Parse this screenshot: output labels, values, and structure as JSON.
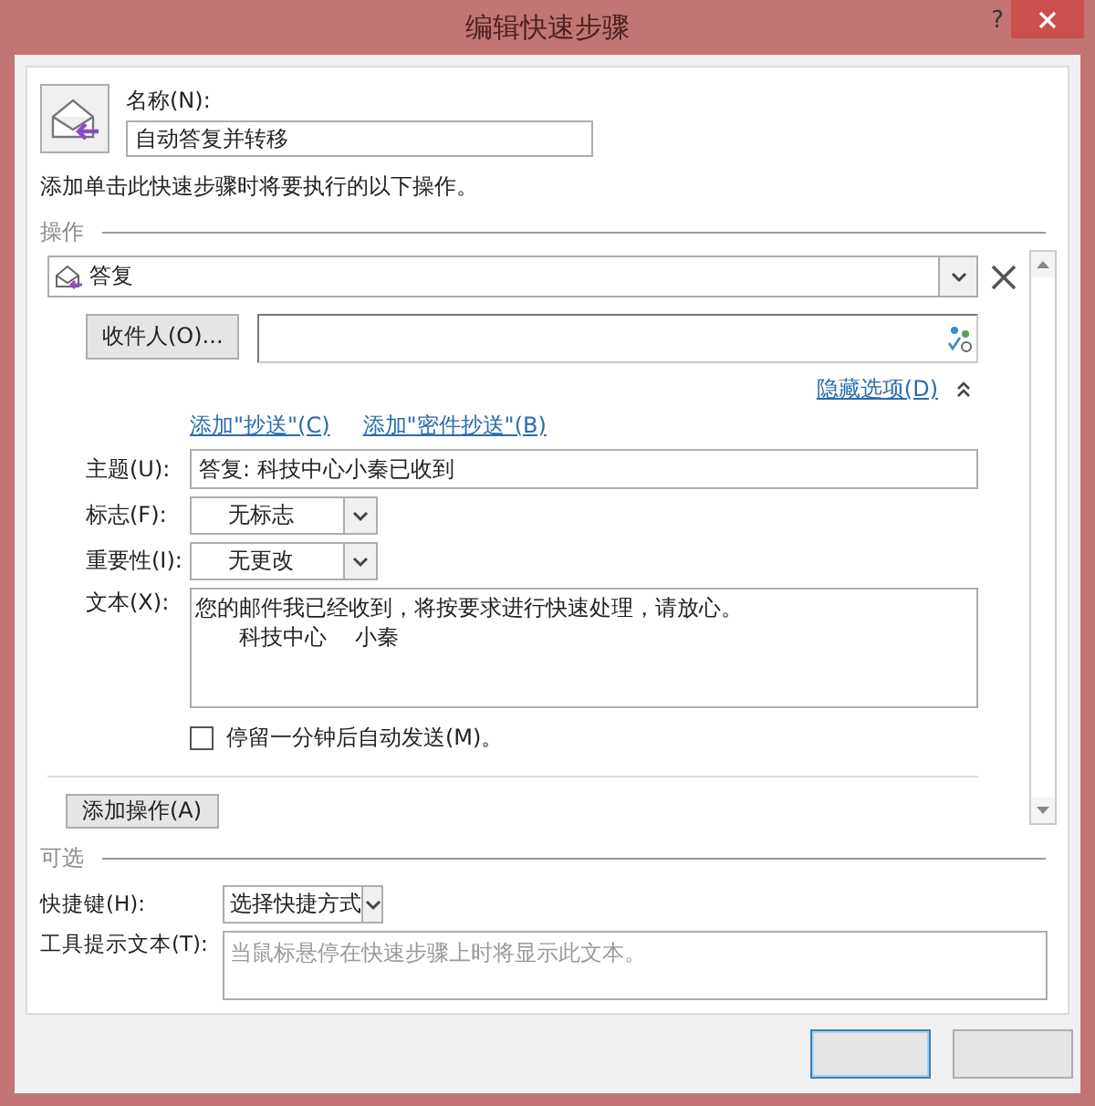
{
  "window": {
    "title": "编辑快速步骤",
    "help": "?"
  },
  "name": {
    "label": "名称(N):",
    "value": "自动答复并转移"
  },
  "instruction": "添加单击此快速步骤时将要执行的以下操作。",
  "actions_section": {
    "label": "操作",
    "action": {
      "value": "答复"
    },
    "recipient_button": "收件人(O)...",
    "hide_options": "隐藏选项(D)",
    "add_cc": "添加\"抄送\"(C)",
    "add_bcc": "添加\"密件抄送\"(B)",
    "subject": {
      "label": "主题(U):",
      "value": "答复: 科技中心小秦已收到"
    },
    "flag": {
      "label": "标志(F):",
      "value": "无标志"
    },
    "importance": {
      "label": "重要性(I):",
      "value": "无更改"
    },
    "text": {
      "label": "文本(X):",
      "lines": [
        "您的邮件我已经收到，将按要求进行快速处理，请放心。",
        "科技中心    小秦"
      ]
    },
    "delay_send": {
      "label": "停留一分钟后自动发送(M)。",
      "checked": false
    },
    "add_action": "添加操作(A)"
  },
  "optional": {
    "label": "可选",
    "shortcut": {
      "label": "快捷键(H):",
      "value": "选择快捷方式"
    },
    "tooltip": {
      "label": "工具提示文本(T):",
      "placeholder": "当鼠标悬停在快速步骤上时将显示此文本。"
    }
  }
}
